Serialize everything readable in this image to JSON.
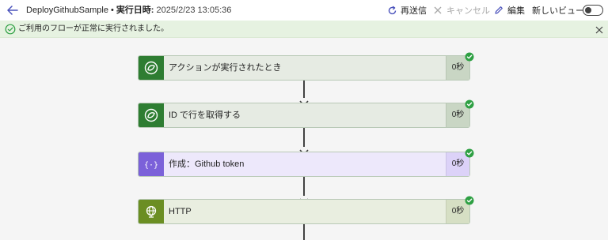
{
  "header": {
    "flow_name": "DeployGithubSample",
    "separator": "•",
    "run_label": "実行日時:",
    "run_time": "2025/2/23 13:05:36",
    "resend_label": "再送信",
    "cancel_label": "キャンセル",
    "edit_label": "編集",
    "new_view_label": "新しいビュー"
  },
  "banner": {
    "message": "ご利用のフローが正常に実行されました。"
  },
  "steps": [
    {
      "name": "アクションが実行されたとき",
      "duration": "0秒",
      "icon": "dataverse-icon",
      "accent": "#2e7d32",
      "body": "#e6ebe3",
      "dur_bg": "#c9d6c4"
    },
    {
      "name": "ID で行を取得する",
      "duration": "0秒",
      "icon": "dataverse-icon",
      "accent": "#2e7d32",
      "body": "#e6ebe3",
      "dur_bg": "#c9d6c4"
    },
    {
      "name": "作成：Github token",
      "duration": "0秒",
      "icon": "compose-icon",
      "accent": "#7b61d9",
      "body": "#ede8fb",
      "dur_bg": "#dcd2f8"
    },
    {
      "name": "HTTP",
      "duration": "0秒",
      "icon": "globe-icon",
      "accent": "#6b8e23",
      "body": "#e9eee0",
      "dur_bg": "#d6dfc4"
    }
  ],
  "colors": {
    "success": "#2ea043",
    "primary": "#4b53bc",
    "banner_bg": "#e6f2e1"
  }
}
